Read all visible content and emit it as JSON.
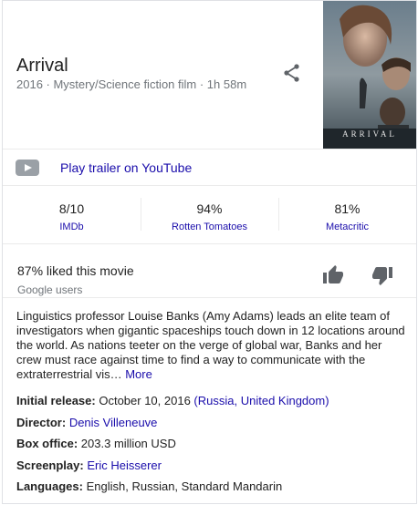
{
  "movie": {
    "title": "Arrival",
    "subtitle": "2016 · Mystery/Science fiction film · 1h 58m",
    "poster_text": "ARRIVAL"
  },
  "trailer": {
    "label": "Play trailer on YouTube"
  },
  "ratings": [
    {
      "value": "8/10",
      "source": "IMDb"
    },
    {
      "value": "94%",
      "source": "Rotten Tomatoes"
    },
    {
      "value": "81%",
      "source": "Metacritic"
    }
  ],
  "likes": {
    "text": "87% liked this movie",
    "source": "Google users"
  },
  "description": {
    "text": "Linguistics professor Louise Banks (Amy Adams) leads an elite team of investigators when gigantic spaceships touch down in 12 locations around the world. As nations teeter on the verge of global war, Banks and her crew must race against time to find a way to communicate with the extraterrestrial vis…",
    "more_label": "More"
  },
  "facts": {
    "release": {
      "label": "Initial release:",
      "value": "October 10, 2016",
      "paren_open": " (",
      "countries": "Russia, United Kingdom",
      "paren_close": ")"
    },
    "director": {
      "label": "Director:",
      "value": "Denis Villeneuve"
    },
    "box_office": {
      "label": "Box office:",
      "value": "203.3 million USD"
    },
    "screenplay": {
      "label": "Screenplay:",
      "value": "Eric Heisserer"
    },
    "languages": {
      "label": "Languages:",
      "value": "English, Russian, Standard Mandarin"
    }
  },
  "icons": {
    "share": "share-icon",
    "youtube": "youtube-icon",
    "thumb_up": "thumb-up-icon",
    "thumb_down": "thumb-down-icon"
  },
  "colors": {
    "link": "#1a0dab",
    "muted": "#70757a",
    "icon": "#5f6368"
  }
}
